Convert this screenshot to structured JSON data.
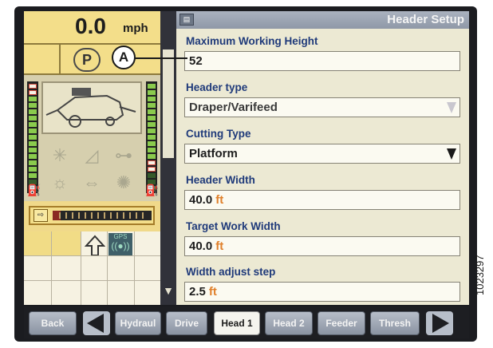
{
  "status": {
    "speed_value": "0.0",
    "speed_unit": "mph",
    "park_label": "P"
  },
  "header": {
    "title": "Header Setup"
  },
  "fields": [
    {
      "label": "Maximum Working Height",
      "value": "52",
      "unit": ""
    },
    {
      "label": "Header type",
      "value": "Draper/Varifeed",
      "unit": "",
      "dropdown": true,
      "disabled": true
    },
    {
      "label": "Cutting Type",
      "value": "Platform",
      "unit": "",
      "dropdown": true
    },
    {
      "label": "Header Width",
      "value": "40.0",
      "unit": "ft"
    },
    {
      "label": "Target Work Width",
      "value": "40.0",
      "unit": "ft"
    },
    {
      "label": "Width adjust step",
      "value": "2.5",
      "unit": "ft"
    }
  ],
  "buttons": {
    "back": "Back",
    "hydraul": "Hydraul",
    "drive": "Drive",
    "head1": "Head 1",
    "head2": "Head 2",
    "feeder": "Feeder",
    "thresh": "Thresh"
  },
  "gps_label": "GPS",
  "callout": {
    "label": "A"
  },
  "figure_code": "1023297",
  "colors": {
    "label_blue": "#1f3a7a",
    "unit_orange": "#e0802b",
    "status_yellow": "#f3de8a",
    "title_bar": "#8f98a7"
  },
  "progress_fill": 0.08
}
